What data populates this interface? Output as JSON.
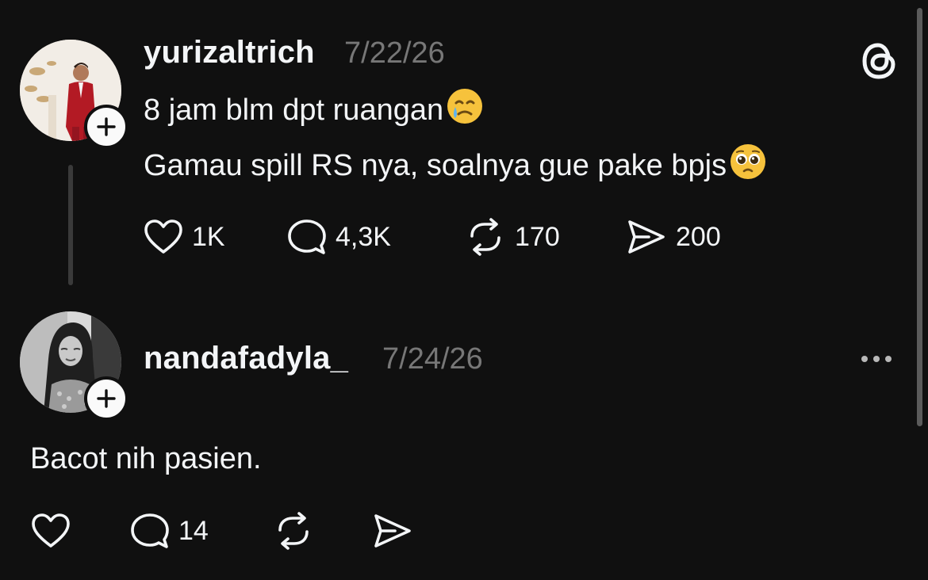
{
  "app": {
    "name": "Threads",
    "logo_icon": "threads-logo-icon"
  },
  "post": {
    "username": "yurizaltrich",
    "timestamp": "7/22/26",
    "lines": [
      "8 jam blm dpt ruangan",
      "Gamau spill RS nya, soalnya gue pake bpjs"
    ],
    "line_emojis": [
      "face-holding-back-tears-crying-emoji",
      "pleading-face-emoji"
    ],
    "actions": {
      "likes": "1K",
      "replies": "4,3K",
      "reposts": "170",
      "shares": "200"
    }
  },
  "reply": {
    "username": "nandafadyla_",
    "timestamp": "7/24/26",
    "text": "Bacot nih pasien.",
    "actions": {
      "likes": "",
      "replies": "14",
      "reposts": "",
      "shares": ""
    }
  },
  "colors": {
    "background": "#101010",
    "text": "#f3f5f7",
    "muted": "#777777",
    "thread_line": "#3a3a3a"
  }
}
